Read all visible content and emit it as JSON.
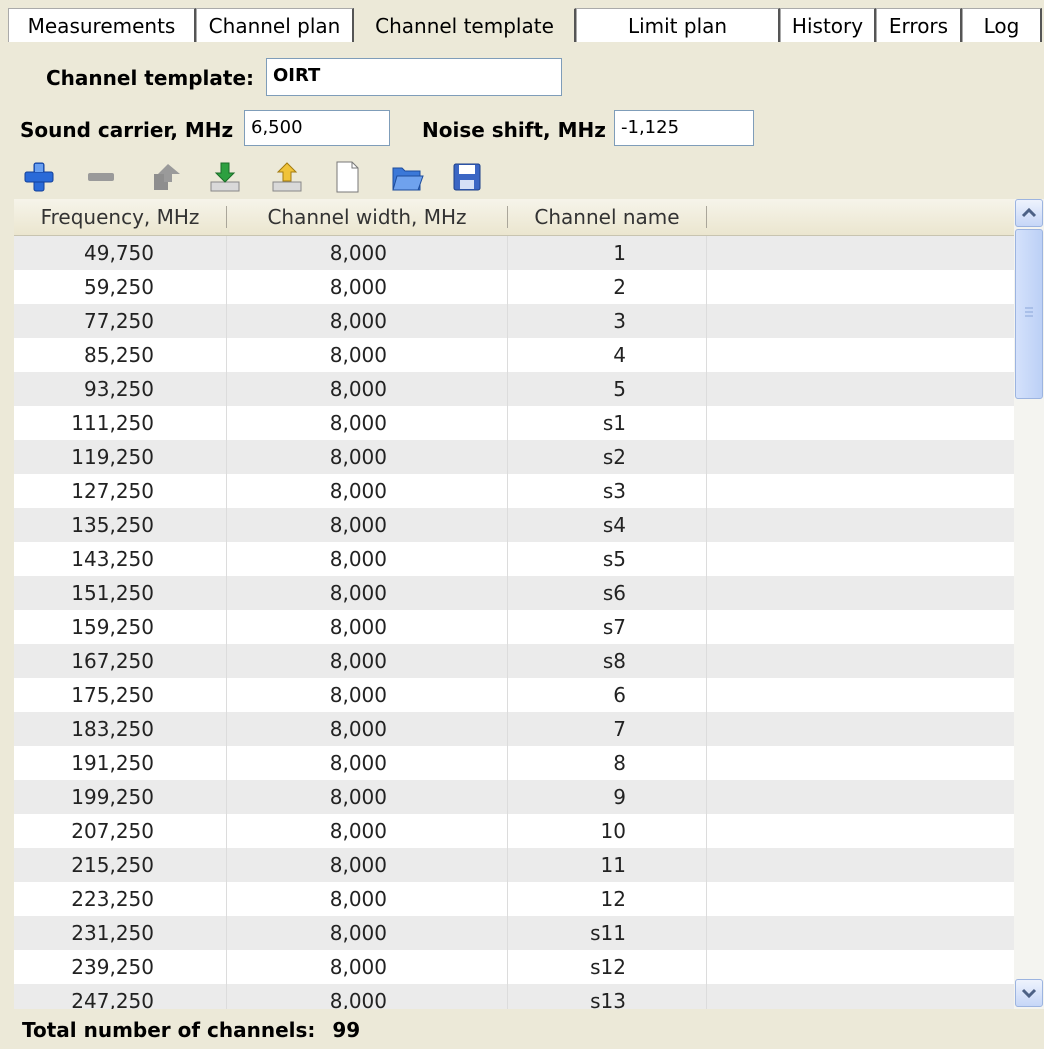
{
  "tabs": [
    {
      "label": "Measurements",
      "active": false
    },
    {
      "label": "Channel plan",
      "active": false
    },
    {
      "label": "Channel template",
      "active": true
    },
    {
      "label": "Limit plan",
      "active": false
    },
    {
      "label": "History",
      "active": false
    },
    {
      "label": "Errors",
      "active": false
    },
    {
      "label": "Log",
      "active": false
    }
  ],
  "form": {
    "template_label": "Channel template:",
    "template_value": "OIRT",
    "sound_label": "Sound carrier, MHz",
    "sound_value": "6,500",
    "noise_label": "Noise shift, MHz",
    "noise_value": "-1,125"
  },
  "toolbar": {
    "icons": [
      "add-icon",
      "remove-icon",
      "move-up-icon",
      "import-icon",
      "export-icon",
      "new-document-icon",
      "open-folder-icon",
      "save-icon"
    ]
  },
  "grid": {
    "columns": [
      "Frequency, MHz",
      "Channel width, MHz",
      "Channel name"
    ],
    "rows": [
      [
        "49,750",
        "8,000",
        "1"
      ],
      [
        "59,250",
        "8,000",
        "2"
      ],
      [
        "77,250",
        "8,000",
        "3"
      ],
      [
        "85,250",
        "8,000",
        "4"
      ],
      [
        "93,250",
        "8,000",
        "5"
      ],
      [
        "111,250",
        "8,000",
        "s1"
      ],
      [
        "119,250",
        "8,000",
        "s2"
      ],
      [
        "127,250",
        "8,000",
        "s3"
      ],
      [
        "135,250",
        "8,000",
        "s4"
      ],
      [
        "143,250",
        "8,000",
        "s5"
      ],
      [
        "151,250",
        "8,000",
        "s6"
      ],
      [
        "159,250",
        "8,000",
        "s7"
      ],
      [
        "167,250",
        "8,000",
        "s8"
      ],
      [
        "175,250",
        "8,000",
        "6"
      ],
      [
        "183,250",
        "8,000",
        "7"
      ],
      [
        "191,250",
        "8,000",
        "8"
      ],
      [
        "199,250",
        "8,000",
        "9"
      ],
      [
        "207,250",
        "8,000",
        "10"
      ],
      [
        "215,250",
        "8,000",
        "11"
      ],
      [
        "223,250",
        "8,000",
        "12"
      ],
      [
        "231,250",
        "8,000",
        "s11"
      ],
      [
        "239,250",
        "8,000",
        "s12"
      ],
      [
        "247,250",
        "8,000",
        "s13"
      ]
    ]
  },
  "footer": {
    "total_label": "Total number of channels:",
    "total_value": "99"
  }
}
